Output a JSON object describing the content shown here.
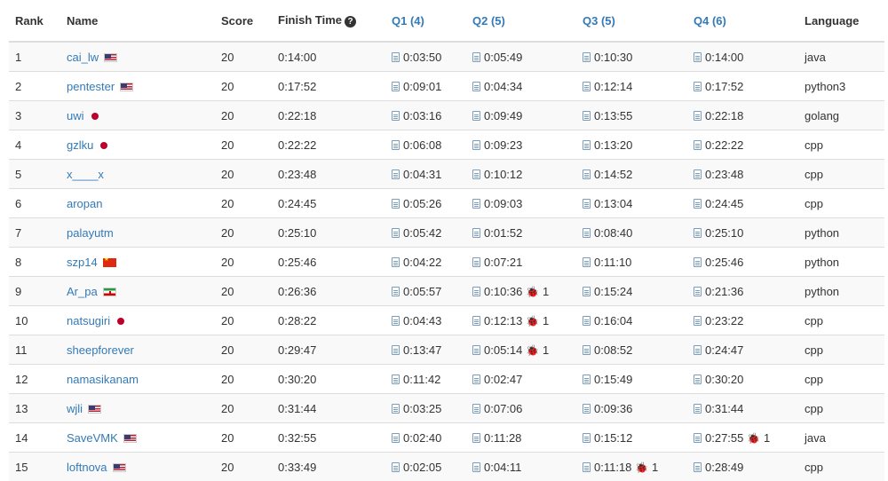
{
  "columns": {
    "rank": "Rank",
    "name": "Name",
    "score": "Score",
    "finish": "Finish Time",
    "q1": "Q1 (4)",
    "q2": "Q2 (5)",
    "q3": "Q3 (5)",
    "q4": "Q4 (6)",
    "lang": "Language"
  },
  "icons": {
    "help": "question-circle-icon",
    "submission": "file-code-icon",
    "bug": "bug-icon"
  },
  "rows": [
    {
      "rank": "1",
      "name": "cai_lw",
      "flag": "us",
      "score": "20",
      "finish": "0:14:00",
      "q": [
        [
          "0:03:50",
          ""
        ],
        [
          "0:05:49",
          ""
        ],
        [
          "0:10:30",
          ""
        ],
        [
          "0:14:00",
          ""
        ]
      ],
      "lang": "java"
    },
    {
      "rank": "2",
      "name": "pentester",
      "flag": "us",
      "score": "20",
      "finish": "0:17:52",
      "q": [
        [
          "0:09:01",
          ""
        ],
        [
          "0:04:34",
          ""
        ],
        [
          "0:12:14",
          ""
        ],
        [
          "0:17:52",
          ""
        ]
      ],
      "lang": "python3"
    },
    {
      "rank": "3",
      "name": "uwi",
      "flag": "jp",
      "score": "20",
      "finish": "0:22:18",
      "q": [
        [
          "0:03:16",
          ""
        ],
        [
          "0:09:49",
          ""
        ],
        [
          "0:13:55",
          ""
        ],
        [
          "0:22:18",
          ""
        ]
      ],
      "lang": "golang"
    },
    {
      "rank": "4",
      "name": "gzlku",
      "flag": "jp",
      "score": "20",
      "finish": "0:22:22",
      "q": [
        [
          "0:06:08",
          ""
        ],
        [
          "0:09:23",
          ""
        ],
        [
          "0:13:20",
          ""
        ],
        [
          "0:22:22",
          ""
        ]
      ],
      "lang": "cpp"
    },
    {
      "rank": "5",
      "name": "x____x",
      "flag": "",
      "score": "20",
      "finish": "0:23:48",
      "q": [
        [
          "0:04:31",
          ""
        ],
        [
          "0:10:12",
          ""
        ],
        [
          "0:14:52",
          ""
        ],
        [
          "0:23:48",
          ""
        ]
      ],
      "lang": "cpp"
    },
    {
      "rank": "6",
      "name": "aropan",
      "flag": "",
      "score": "20",
      "finish": "0:24:45",
      "q": [
        [
          "0:05:26",
          ""
        ],
        [
          "0:09:03",
          ""
        ],
        [
          "0:13:04",
          ""
        ],
        [
          "0:24:45",
          ""
        ]
      ],
      "lang": "cpp"
    },
    {
      "rank": "7",
      "name": "palayutm",
      "flag": "",
      "score": "20",
      "finish": "0:25:10",
      "q": [
        [
          "0:05:42",
          ""
        ],
        [
          "0:01:52",
          ""
        ],
        [
          "0:08:40",
          ""
        ],
        [
          "0:25:10",
          ""
        ]
      ],
      "lang": "python"
    },
    {
      "rank": "8",
      "name": "szp14",
      "flag": "cn",
      "score": "20",
      "finish": "0:25:46",
      "q": [
        [
          "0:04:22",
          ""
        ],
        [
          "0:07:21",
          ""
        ],
        [
          "0:11:10",
          ""
        ],
        [
          "0:25:46",
          ""
        ]
      ],
      "lang": "python"
    },
    {
      "rank": "9",
      "name": "Ar_pa",
      "flag": "ir",
      "score": "20",
      "finish": "0:26:36",
      "q": [
        [
          "0:05:57",
          ""
        ],
        [
          "0:10:36",
          "1"
        ],
        [
          "0:15:24",
          ""
        ],
        [
          "0:21:36",
          ""
        ]
      ],
      "lang": "python"
    },
    {
      "rank": "10",
      "name": "natsugiri",
      "flag": "jp",
      "score": "20",
      "finish": "0:28:22",
      "q": [
        [
          "0:04:43",
          ""
        ],
        [
          "0:12:13",
          "1"
        ],
        [
          "0:16:04",
          ""
        ],
        [
          "0:23:22",
          ""
        ]
      ],
      "lang": "cpp"
    },
    {
      "rank": "11",
      "name": "sheepforever",
      "flag": "",
      "score": "20",
      "finish": "0:29:47",
      "q": [
        [
          "0:13:47",
          ""
        ],
        [
          "0:05:14",
          "1"
        ],
        [
          "0:08:52",
          ""
        ],
        [
          "0:24:47",
          ""
        ]
      ],
      "lang": "cpp"
    },
    {
      "rank": "12",
      "name": "namasikanam",
      "flag": "",
      "score": "20",
      "finish": "0:30:20",
      "q": [
        [
          "0:11:42",
          ""
        ],
        [
          "0:02:47",
          ""
        ],
        [
          "0:15:49",
          ""
        ],
        [
          "0:30:20",
          ""
        ]
      ],
      "lang": "cpp"
    },
    {
      "rank": "13",
      "name": "wjli",
      "flag": "us",
      "score": "20",
      "finish": "0:31:44",
      "q": [
        [
          "0:03:25",
          ""
        ],
        [
          "0:07:06",
          ""
        ],
        [
          "0:09:36",
          ""
        ],
        [
          "0:31:44",
          ""
        ]
      ],
      "lang": "cpp"
    },
    {
      "rank": "14",
      "name": "SaveVMK",
      "flag": "us",
      "score": "20",
      "finish": "0:32:55",
      "q": [
        [
          "0:02:40",
          ""
        ],
        [
          "0:11:28",
          ""
        ],
        [
          "0:15:12",
          ""
        ],
        [
          "0:27:55",
          "1"
        ]
      ],
      "lang": "java"
    },
    {
      "rank": "15",
      "name": "loftnova",
      "flag": "us",
      "score": "20",
      "finish": "0:33:49",
      "q": [
        [
          "0:02:05",
          ""
        ],
        [
          "0:04:11",
          ""
        ],
        [
          "0:11:18",
          "1"
        ],
        [
          "0:28:49",
          ""
        ]
      ],
      "lang": "cpp"
    }
  ]
}
